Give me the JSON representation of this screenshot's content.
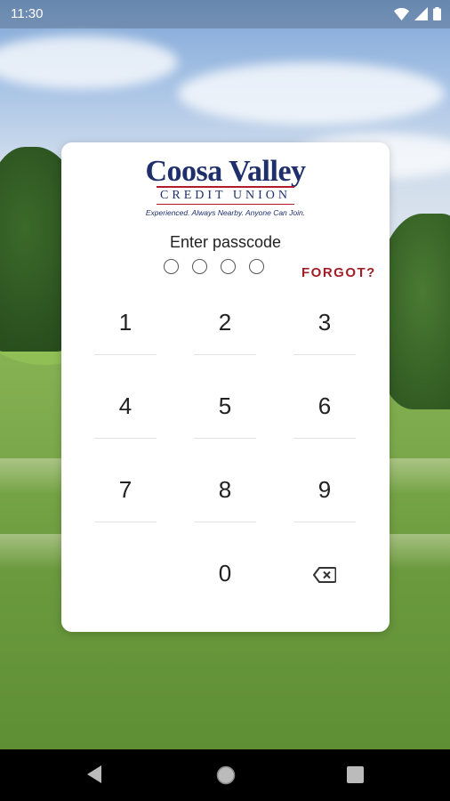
{
  "status_bar": {
    "time": "11:30",
    "icons": [
      "wifi-icon",
      "signal-icon",
      "battery-icon"
    ]
  },
  "logo": {
    "name": "Coosa Valley",
    "sub": "CREDIT UNION",
    "tagline": "Experienced.  Always Nearby.  Anyone Can Join."
  },
  "passcode": {
    "prompt": "Enter passcode",
    "digit_slots": 4,
    "forgot_label": "FORGOT?"
  },
  "keypad": {
    "keys": [
      "1",
      "2",
      "3",
      "4",
      "5",
      "6",
      "7",
      "8",
      "9",
      "0"
    ],
    "delete_icon": "backspace-icon"
  },
  "nav_bar": {
    "buttons": [
      "back-icon",
      "home-icon",
      "recents-icon"
    ]
  },
  "colors": {
    "brand_navy": "#1f2f6b",
    "brand_red": "#a01e25",
    "card_bg": "#ffffff"
  }
}
